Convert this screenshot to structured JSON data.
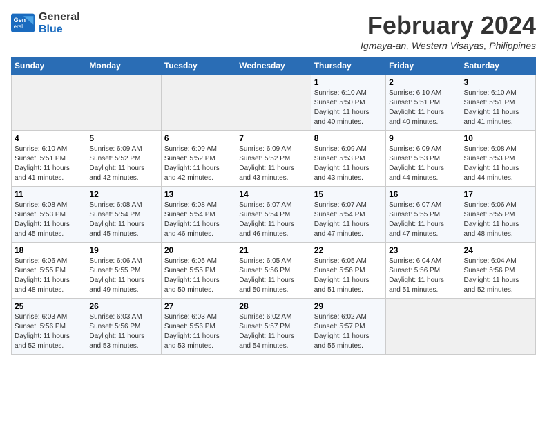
{
  "header": {
    "logo_line1": "General",
    "logo_line2": "Blue",
    "month_year": "February 2024",
    "location": "Igmaya-an, Western Visayas, Philippines"
  },
  "days_of_week": [
    "Sunday",
    "Monday",
    "Tuesday",
    "Wednesday",
    "Thursday",
    "Friday",
    "Saturday"
  ],
  "weeks": [
    [
      {
        "day": "",
        "info": ""
      },
      {
        "day": "",
        "info": ""
      },
      {
        "day": "",
        "info": ""
      },
      {
        "day": "",
        "info": ""
      },
      {
        "day": "1",
        "info": "Sunrise: 6:10 AM\nSunset: 5:50 PM\nDaylight: 11 hours\nand 40 minutes."
      },
      {
        "day": "2",
        "info": "Sunrise: 6:10 AM\nSunset: 5:51 PM\nDaylight: 11 hours\nand 40 minutes."
      },
      {
        "day": "3",
        "info": "Sunrise: 6:10 AM\nSunset: 5:51 PM\nDaylight: 11 hours\nand 41 minutes."
      }
    ],
    [
      {
        "day": "4",
        "info": "Sunrise: 6:10 AM\nSunset: 5:51 PM\nDaylight: 11 hours\nand 41 minutes."
      },
      {
        "day": "5",
        "info": "Sunrise: 6:09 AM\nSunset: 5:52 PM\nDaylight: 11 hours\nand 42 minutes."
      },
      {
        "day": "6",
        "info": "Sunrise: 6:09 AM\nSunset: 5:52 PM\nDaylight: 11 hours\nand 42 minutes."
      },
      {
        "day": "7",
        "info": "Sunrise: 6:09 AM\nSunset: 5:52 PM\nDaylight: 11 hours\nand 43 minutes."
      },
      {
        "day": "8",
        "info": "Sunrise: 6:09 AM\nSunset: 5:53 PM\nDaylight: 11 hours\nand 43 minutes."
      },
      {
        "day": "9",
        "info": "Sunrise: 6:09 AM\nSunset: 5:53 PM\nDaylight: 11 hours\nand 44 minutes."
      },
      {
        "day": "10",
        "info": "Sunrise: 6:08 AM\nSunset: 5:53 PM\nDaylight: 11 hours\nand 44 minutes."
      }
    ],
    [
      {
        "day": "11",
        "info": "Sunrise: 6:08 AM\nSunset: 5:53 PM\nDaylight: 11 hours\nand 45 minutes."
      },
      {
        "day": "12",
        "info": "Sunrise: 6:08 AM\nSunset: 5:54 PM\nDaylight: 11 hours\nand 45 minutes."
      },
      {
        "day": "13",
        "info": "Sunrise: 6:08 AM\nSunset: 5:54 PM\nDaylight: 11 hours\nand 46 minutes."
      },
      {
        "day": "14",
        "info": "Sunrise: 6:07 AM\nSunset: 5:54 PM\nDaylight: 11 hours\nand 46 minutes."
      },
      {
        "day": "15",
        "info": "Sunrise: 6:07 AM\nSunset: 5:54 PM\nDaylight: 11 hours\nand 47 minutes."
      },
      {
        "day": "16",
        "info": "Sunrise: 6:07 AM\nSunset: 5:55 PM\nDaylight: 11 hours\nand 47 minutes."
      },
      {
        "day": "17",
        "info": "Sunrise: 6:06 AM\nSunset: 5:55 PM\nDaylight: 11 hours\nand 48 minutes."
      }
    ],
    [
      {
        "day": "18",
        "info": "Sunrise: 6:06 AM\nSunset: 5:55 PM\nDaylight: 11 hours\nand 48 minutes."
      },
      {
        "day": "19",
        "info": "Sunrise: 6:06 AM\nSunset: 5:55 PM\nDaylight: 11 hours\nand 49 minutes."
      },
      {
        "day": "20",
        "info": "Sunrise: 6:05 AM\nSunset: 5:55 PM\nDaylight: 11 hours\nand 50 minutes."
      },
      {
        "day": "21",
        "info": "Sunrise: 6:05 AM\nSunset: 5:56 PM\nDaylight: 11 hours\nand 50 minutes."
      },
      {
        "day": "22",
        "info": "Sunrise: 6:05 AM\nSunset: 5:56 PM\nDaylight: 11 hours\nand 51 minutes."
      },
      {
        "day": "23",
        "info": "Sunrise: 6:04 AM\nSunset: 5:56 PM\nDaylight: 11 hours\nand 51 minutes."
      },
      {
        "day": "24",
        "info": "Sunrise: 6:04 AM\nSunset: 5:56 PM\nDaylight: 11 hours\nand 52 minutes."
      }
    ],
    [
      {
        "day": "25",
        "info": "Sunrise: 6:03 AM\nSunset: 5:56 PM\nDaylight: 11 hours\nand 52 minutes."
      },
      {
        "day": "26",
        "info": "Sunrise: 6:03 AM\nSunset: 5:56 PM\nDaylight: 11 hours\nand 53 minutes."
      },
      {
        "day": "27",
        "info": "Sunrise: 6:03 AM\nSunset: 5:56 PM\nDaylight: 11 hours\nand 53 minutes."
      },
      {
        "day": "28",
        "info": "Sunrise: 6:02 AM\nSunset: 5:57 PM\nDaylight: 11 hours\nand 54 minutes."
      },
      {
        "day": "29",
        "info": "Sunrise: 6:02 AM\nSunset: 5:57 PM\nDaylight: 11 hours\nand 55 minutes."
      },
      {
        "day": "",
        "info": ""
      },
      {
        "day": "",
        "info": ""
      }
    ]
  ]
}
